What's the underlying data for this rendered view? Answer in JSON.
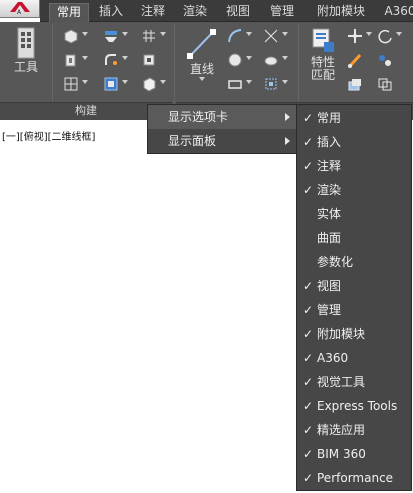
{
  "app_button": {
    "letter": "A"
  },
  "tabs": [
    "常用",
    "插入",
    "注释",
    "渲染",
    "视图",
    "管理",
    "附加模块",
    "A360"
  ],
  "active_tab": "常用",
  "ribbon": {
    "tools_label": "工具",
    "line_label": "直线",
    "properties_label": "特性\n匹配",
    "panel_title": "构建"
  },
  "viewport_label": "[一][俯视][二维线框]",
  "context_menu": {
    "items": [
      {
        "label": "显示选项卡",
        "has_submenu": true,
        "highlighted": true
      },
      {
        "label": "显示面板",
        "has_submenu": true,
        "highlighted": false
      }
    ]
  },
  "tabs_submenu": {
    "check_mark": "✓",
    "items": [
      {
        "label": "常用",
        "checked": true
      },
      {
        "label": "插入",
        "checked": true
      },
      {
        "label": "注释",
        "checked": true
      },
      {
        "label": "渲染",
        "checked": true
      },
      {
        "label": "实体",
        "checked": false
      },
      {
        "label": "曲面",
        "checked": false
      },
      {
        "label": "参数化",
        "checked": false
      },
      {
        "label": "视图",
        "checked": true
      },
      {
        "label": "管理",
        "checked": true
      },
      {
        "label": "附加模块",
        "checked": true
      },
      {
        "label": "A360",
        "checked": true
      },
      {
        "label": "视觉工具",
        "checked": true
      },
      {
        "label": "Express Tools",
        "checked": true
      },
      {
        "label": "精选应用",
        "checked": true
      },
      {
        "label": "BIM 360",
        "checked": true
      },
      {
        "label": "Performance",
        "checked": true
      }
    ]
  },
  "colors": {
    "ribbon_bg": "#575757",
    "menu_bg": "#474747",
    "highlight": "#5a5a5a",
    "brand_red": "#c8102e"
  }
}
